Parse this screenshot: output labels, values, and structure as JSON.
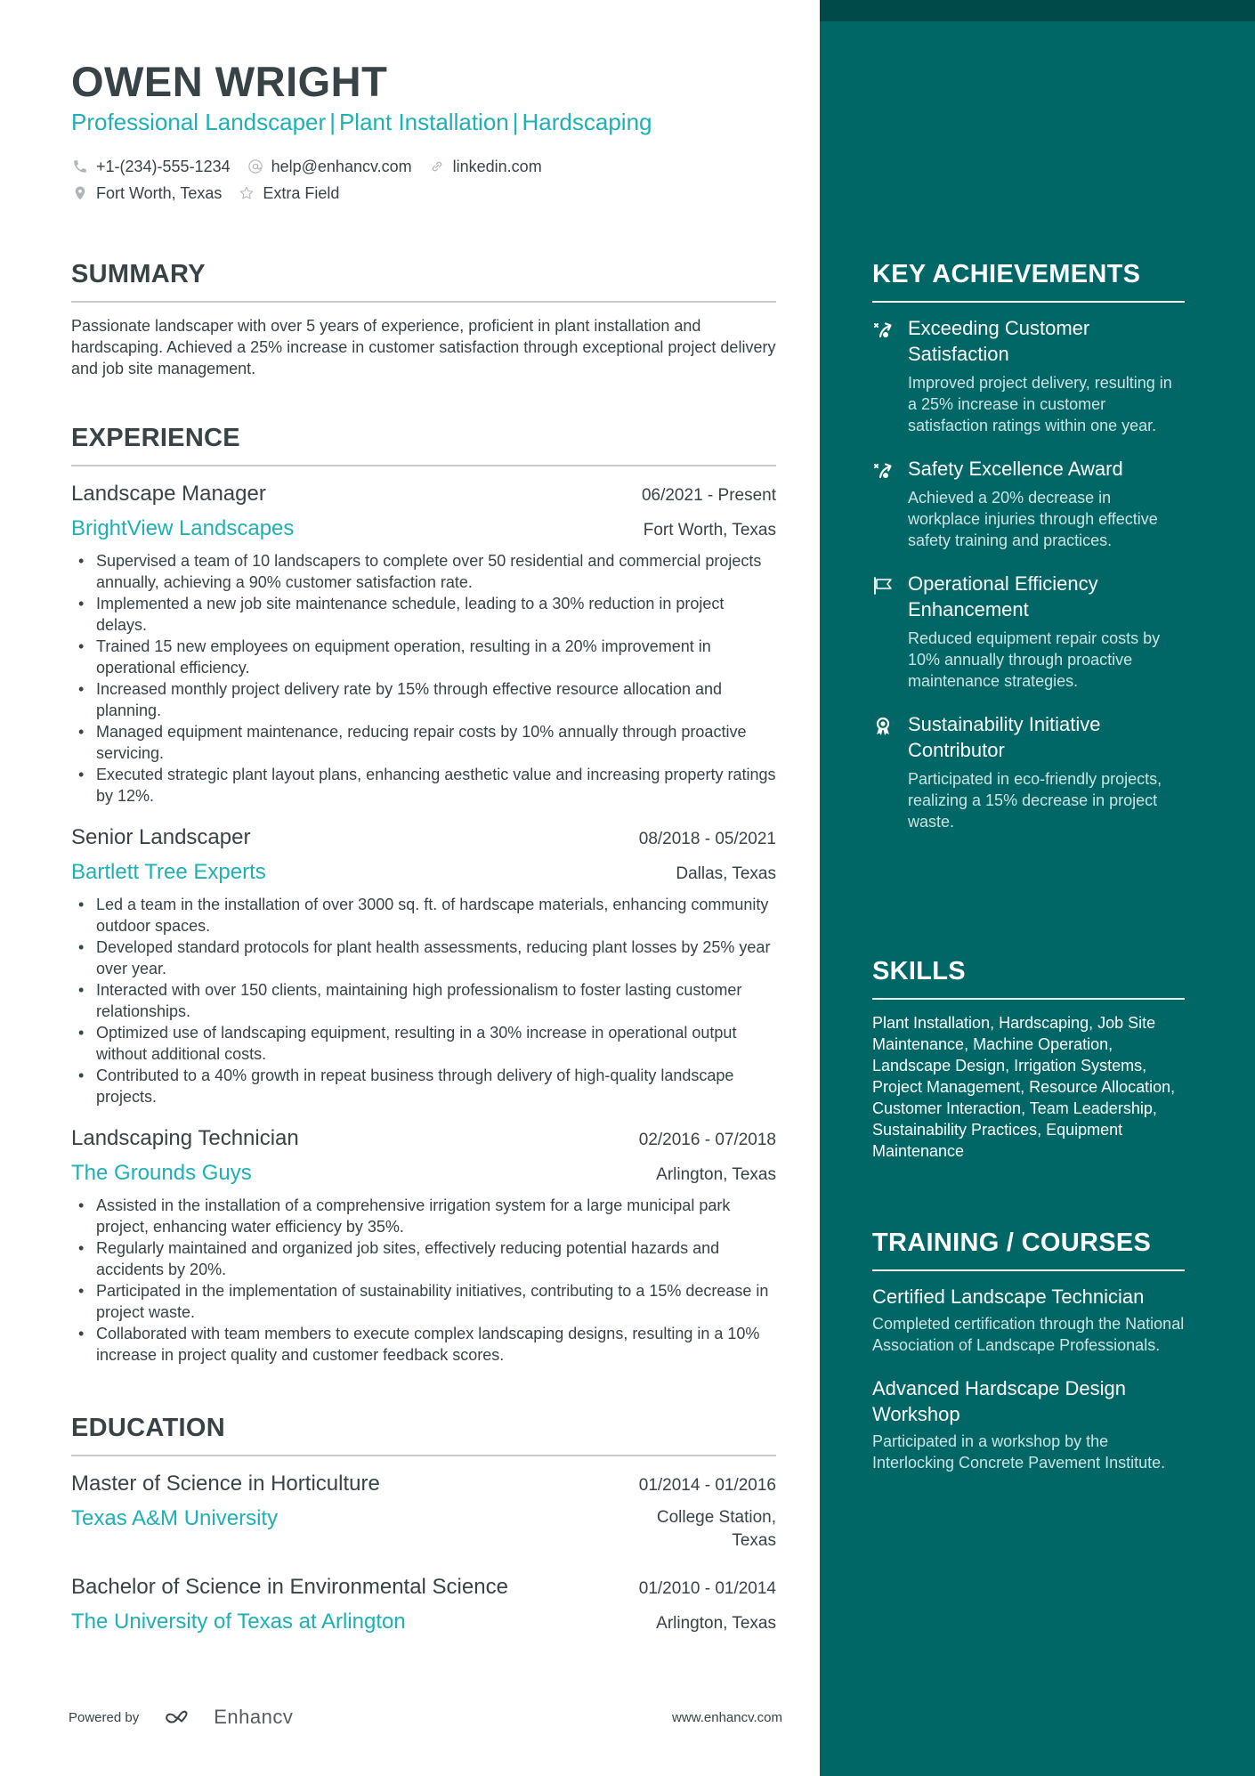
{
  "header": {
    "name": "OWEN WRIGHT",
    "headline_parts": [
      "Professional Landscaper",
      "Plant Installation",
      "Hardscaping"
    ],
    "separator": "|",
    "contacts": {
      "phone": {
        "icon": "phone-icon",
        "text": "+1-(234)-555-1234"
      },
      "email": {
        "icon": "at-icon",
        "text": "help@enhancv.com"
      },
      "link": {
        "icon": "link-icon",
        "text": "linkedin.com"
      },
      "location": {
        "icon": "location-pin-icon",
        "text": "Fort Worth, Texas"
      },
      "extra": {
        "icon": "star-icon",
        "text": "Extra Field"
      }
    }
  },
  "summary": {
    "title": "SUMMARY",
    "text": "Passionate landscaper with over 5 years of experience, proficient in plant installation and hardscaping. Achieved a 25% increase in customer satisfaction through exceptional project delivery and job site management."
  },
  "experience": {
    "title": "EXPERIENCE",
    "jobs": [
      {
        "title": "Landscape Manager",
        "dates": "06/2021 - Present",
        "company": "BrightView Landscapes",
        "location": "Fort Worth, Texas",
        "bullets": [
          "Supervised a team of 10 landscapers to complete over 50 residential and commercial projects annually, achieving a 90% customer satisfaction rate.",
          "Implemented a new job site maintenance schedule, leading to a 30% reduction in project delays.",
          "Trained 15 new employees on equipment operation, resulting in a 20% improvement in operational efficiency.",
          "Increased monthly project delivery rate by 15% through effective resource allocation and planning.",
          "Managed equipment maintenance, reducing repair costs by 10% annually through proactive servicing.",
          "Executed strategic plant layout plans, enhancing aesthetic value and increasing property ratings by 12%."
        ]
      },
      {
        "title": "Senior Landscaper",
        "dates": "08/2018 - 05/2021",
        "company": "Bartlett Tree Experts",
        "location": "Dallas, Texas",
        "bullets": [
          "Led a team in the installation of over 3000 sq. ft. of hardscape materials, enhancing community outdoor spaces.",
          "Developed standard protocols for plant health assessments, reducing plant losses by 25% year over year.",
          "Interacted with over 150 clients, maintaining high professionalism to foster lasting customer relationships.",
          "Optimized use of landscaping equipment, resulting in a 30% increase in operational output without additional costs.",
          "Contributed to a 40% growth in repeat business through delivery of high-quality landscape projects."
        ]
      },
      {
        "title": "Landscaping Technician",
        "dates": "02/2016 - 07/2018",
        "company": "The Grounds Guys",
        "location": "Arlington, Texas",
        "bullets": [
          "Assisted in the installation of a comprehensive irrigation system for a large municipal park project, enhancing water efficiency by 35%.",
          "Regularly maintained and organized job sites, effectively reducing potential hazards and accidents by 20%.",
          "Participated in the implementation of sustainability initiatives, contributing to a 15% decrease in project waste.",
          "Collaborated with team members to execute complex landscaping designs, resulting in a 10% increase in project quality and customer feedback scores."
        ]
      }
    ]
  },
  "education": {
    "title": "EDUCATION",
    "items": [
      {
        "degree": "Master of Science in Horticulture",
        "dates": "01/2014 - 01/2016",
        "school": "Texas A&M University",
        "location_line1": "College Station,",
        "location_line2": "Texas"
      },
      {
        "degree": "Bachelor of Science in Environmental Science",
        "dates": "01/2010 - 01/2014",
        "school": "The University of Texas at Arlington",
        "location_line1": "Arlington, Texas",
        "location_line2": ""
      }
    ]
  },
  "footer": {
    "powered_by": "Powered by",
    "brand": "Enhancv",
    "website": "www.enhancv.com"
  },
  "sidebar": {
    "achievements": {
      "title": "KEY ACHIEVEMENTS",
      "items": [
        {
          "icon": "strategy-arrow-icon",
          "title": "Exceeding Customer Satisfaction",
          "desc": "Improved project delivery, resulting in a 25% increase in customer satisfaction ratings within one year."
        },
        {
          "icon": "strategy-arrow-icon",
          "title": "Safety Excellence Award",
          "desc": "Achieved a 20% decrease in workplace injuries through effective safety training and practices."
        },
        {
          "icon": "flag-icon",
          "title": "Operational Efficiency Enhancement",
          "desc": "Reduced equipment repair costs by 10% annually through proactive maintenance strategies."
        },
        {
          "icon": "award-medal-icon",
          "title": "Sustainability Initiative Contributor",
          "desc": "Participated in eco-friendly projects, realizing a 15% decrease in project waste."
        }
      ]
    },
    "skills": {
      "title": "SKILLS",
      "text": "Plant Installation, Hardscaping, Job Site Maintenance, Machine Operation, Landscape Design, Irrigation Systems, Project Management, Resource Allocation, Customer Interaction, Team Leadership, Sustainability Practices, Equipment Maintenance"
    },
    "training": {
      "title": "TRAINING / COURSES",
      "items": [
        {
          "title": "Certified Landscape Technician",
          "desc": "Completed certification through the National Association of Landscape Professionals."
        },
        {
          "title": "Advanced Hardscape Design Workshop",
          "desc": "Participated in a workshop by the Interlocking Concrete Pavement Institute."
        }
      ]
    }
  },
  "colors": {
    "accent": "#1eb0b3",
    "text": "#384347",
    "sidebar": "#006666",
    "sidebar_band": "#004a4a"
  }
}
